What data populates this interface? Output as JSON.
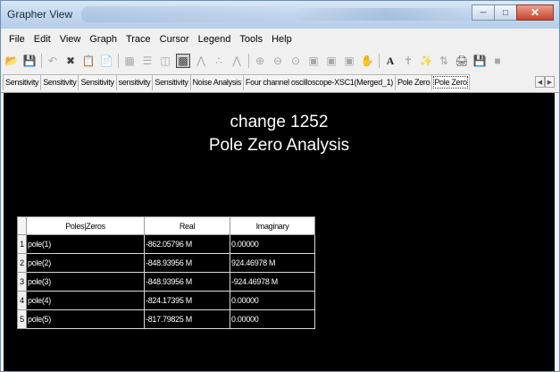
{
  "window": {
    "title": "Grapher View"
  },
  "menu": [
    "File",
    "Edit",
    "View",
    "Graph",
    "Trace",
    "Cursor",
    "Legend",
    "Tools",
    "Help"
  ],
  "toolbar_icons": [
    "open-icon",
    "save-icon",
    "undo-icon",
    "cut-icon",
    "copy-icon",
    "paste-icon",
    "grid-icon",
    "list-icon",
    "table-icon",
    "graph-mode-icon",
    "line-plot-icon",
    "scatter-plot-icon",
    "mixed-plot-icon",
    "zoom-in-icon",
    "zoom-out-icon",
    "zoom-area-icon",
    "zoom-fit-icon",
    "zoom-x-icon",
    "zoom-y-icon",
    "pan-icon",
    "text-icon",
    "cursor-icon",
    "marker-icon",
    "data-icon",
    "print-icon",
    "export-icon",
    "stop-icon"
  ],
  "toolbar_text_icon": "A",
  "tabs": [
    "Sensitivity",
    "Sensitivity",
    "Sensitivity",
    "sensitivity",
    "Sensitivity",
    "Noise Analysis",
    "Four channel oscilloscope-XSC1(Merged_1)",
    "Pole Zero",
    "Pole Zero"
  ],
  "active_tab_index": 8,
  "graph": {
    "title": "change 1252",
    "subtitle": "Pole Zero Analysis",
    "table": {
      "headers": [
        "Poles|Zeros",
        "Real",
        "Imaginary"
      ],
      "rows": [
        {
          "num": "1",
          "name": "pole(1)",
          "real": "-862.05796 M",
          "imag": "0.00000"
        },
        {
          "num": "2",
          "name": "pole(2)",
          "real": "-848.93956 M",
          "imag": "924.46978 M"
        },
        {
          "num": "3",
          "name": "pole(3)",
          "real": "-848.93956 M",
          "imag": "-924.46978 M"
        },
        {
          "num": "4",
          "name": "pole(4)",
          "real": "-824.17395 M",
          "imag": "0.00000"
        },
        {
          "num": "5",
          "name": "pole(5)",
          "real": "-817.79825 M",
          "imag": "0.00000"
        }
      ]
    }
  }
}
